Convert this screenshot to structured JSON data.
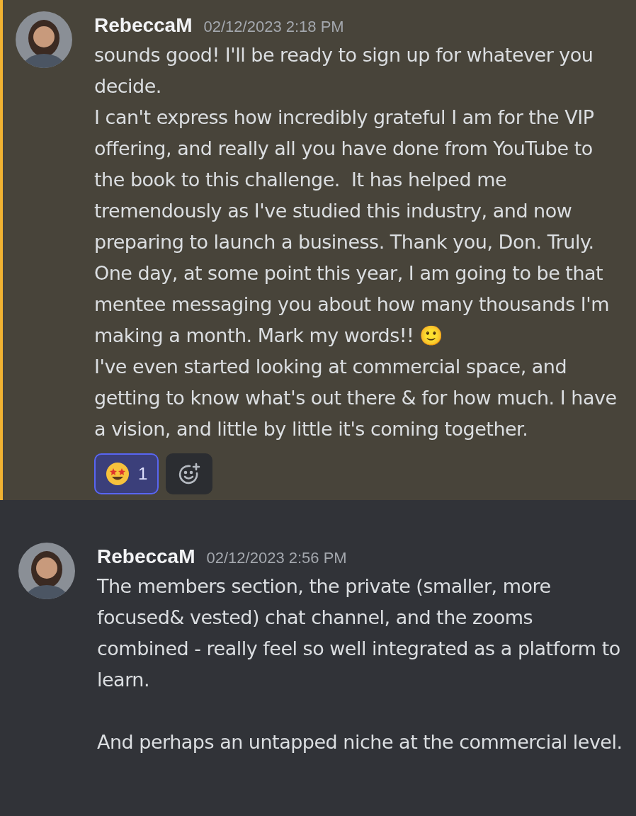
{
  "messages": [
    {
      "author": "RebeccaM",
      "timestamp": "02/12/2023 2:18 PM",
      "highlighted": true,
      "text": "sounds good! I'll be ready to sign up for whatever you decide.\nI can't express how incredibly grateful I am for the VIP offering, and really all you have done from YouTube to the book to this challenge.  It has helped me tremendously as I've studied this industry, and now preparing to launch a business. Thank you, Don. Truly. One day, at some point this year, I am going to be that mentee messaging you about how many thousands I'm making a month. Mark my words!! 🙂\nI've even started looking at commercial space, and getting to know what's out there & for how much. I have a vision, and little by little it's coming together.",
      "reactions": [
        {
          "count": "1",
          "selected": true
        }
      ]
    },
    {
      "author": "RebeccaM",
      "timestamp": "02/12/2023 2:56 PM",
      "highlighted": false,
      "text": "The members section, the private (smaller, more focused& vested) chat channel, and the zooms combined - really feel so well integrated as a platform to learn.\n\nAnd perhaps an untapped niche at the commercial level."
    }
  ]
}
